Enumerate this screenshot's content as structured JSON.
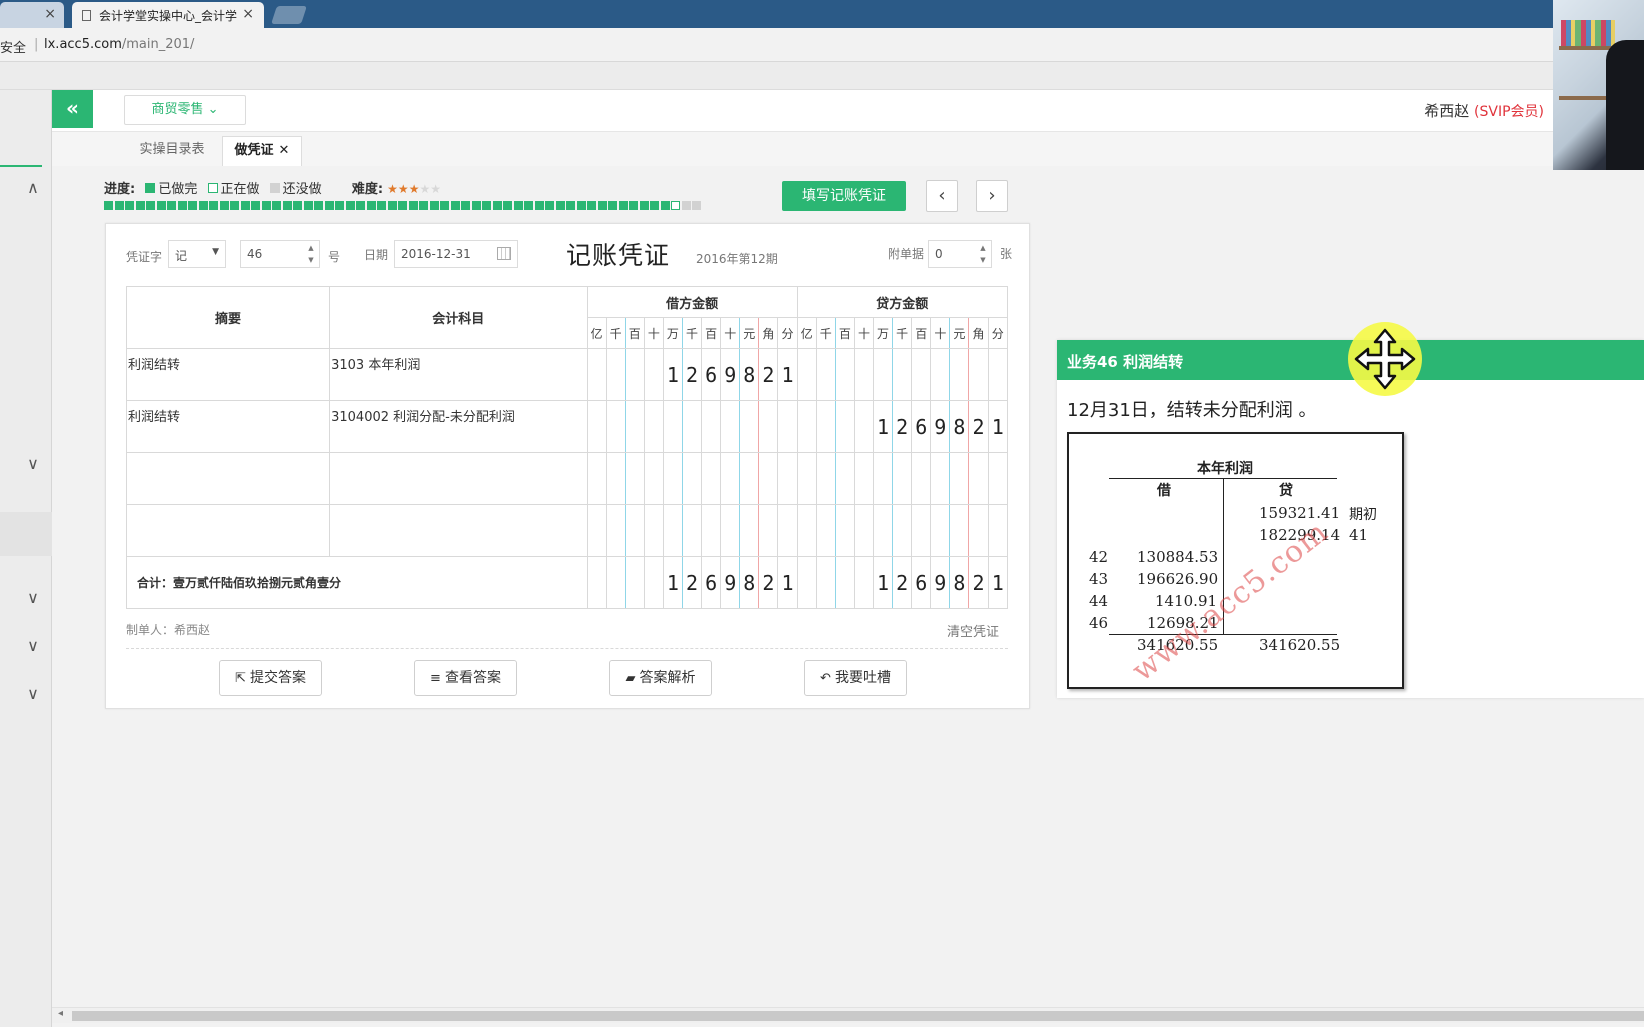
{
  "browser": {
    "active_tab_title": "会计学堂实操中心_会计学",
    "close_glyph": "×",
    "secure_label": "安全",
    "url_host": "lx.acc5.com",
    "url_path": "/main_201/"
  },
  "header": {
    "collapse_glyph": "«",
    "company_select": "商贸零售 ⌄",
    "user_name": "希西赵",
    "user_badge": "(SVIP会员)"
  },
  "app_tabs": [
    {
      "label": "实操目录表"
    },
    {
      "label": "做凭证",
      "close": "✕"
    }
  ],
  "progress": {
    "label": "进度:",
    "legend_done": "已做完",
    "legend_doing": "正在做",
    "legend_todo": "还没做",
    "difficulty_label": "难度:",
    "difficulty_level": 3,
    "difficulty_max": 5,
    "done_count": 54,
    "current_index": 55,
    "total_count": 57
  },
  "toolbar": {
    "fill_button": "填写记账凭证",
    "prev": "‹",
    "next": "›"
  },
  "voucher": {
    "word_label": "凭证字",
    "word_value": "记",
    "number_value": "46",
    "number_suffix": "号",
    "date_label": "日期",
    "date_value": "2016-12-31",
    "title": "记账凭证",
    "period": "2016年第12期",
    "attach_label": "附单据",
    "attach_value": "0",
    "attach_suffix": "张",
    "col_summary": "摘要",
    "col_account": "会计科目",
    "col_debit": "借方金额",
    "col_credit": "贷方金额",
    "digit_headers": [
      "亿",
      "千",
      "百",
      "十",
      "万",
      "千",
      "百",
      "十",
      "元",
      "角",
      "分"
    ],
    "rows": [
      {
        "summary": "利润结转",
        "account": "3103 本年利润",
        "debit": "1269821",
        "credit": ""
      },
      {
        "summary": "利润结转",
        "account": "3104002 利润分配-未分配利润",
        "debit": "",
        "credit": "1269821"
      },
      {
        "summary": "",
        "account": "",
        "debit": "",
        "credit": ""
      },
      {
        "summary": "",
        "account": "",
        "debit": "",
        "credit": ""
      }
    ],
    "total_label": "合计：壹万贰仟陆佰玖拾捌元贰角壹分",
    "total_debit": "1269821",
    "total_credit": "1269821",
    "maker": "制单人：希西赵",
    "clear": "清空凭证"
  },
  "actions": [
    {
      "icon": "external-link-icon",
      "glyph": "⇱",
      "label": "提交答案"
    },
    {
      "icon": "database-icon",
      "glyph": "≡",
      "label": "查看答案"
    },
    {
      "icon": "folder-open-icon",
      "glyph": "▰",
      "label": "答案解析"
    },
    {
      "icon": "reply-icon",
      "glyph": "↶",
      "label": "我要吐槽"
    }
  ],
  "task": {
    "header": "业务46 利润结转",
    "description": "12月31日，结转未分配利润 。",
    "t_account": {
      "title": "本年利润",
      "debit_label": "借",
      "credit_label": "贷",
      "credit_entries": [
        {
          "amount": "159321.41",
          "ref": "期初"
        },
        {
          "amount": "182299.14",
          "ref": "41"
        }
      ],
      "debit_entries": [
        {
          "ref": "42",
          "amount": "130884.53"
        },
        {
          "ref": "43",
          "amount": "196626.90"
        },
        {
          "ref": "44",
          "amount": "1410.91"
        },
        {
          "ref": "46",
          "amount": "12698.21"
        }
      ],
      "debit_total": "341620.55",
      "credit_total": "341620.55",
      "watermark": "www.acc5.com"
    }
  },
  "colors": {
    "accent": "#2bb673",
    "vip": "#e0333b",
    "star": "#e07a2c"
  }
}
